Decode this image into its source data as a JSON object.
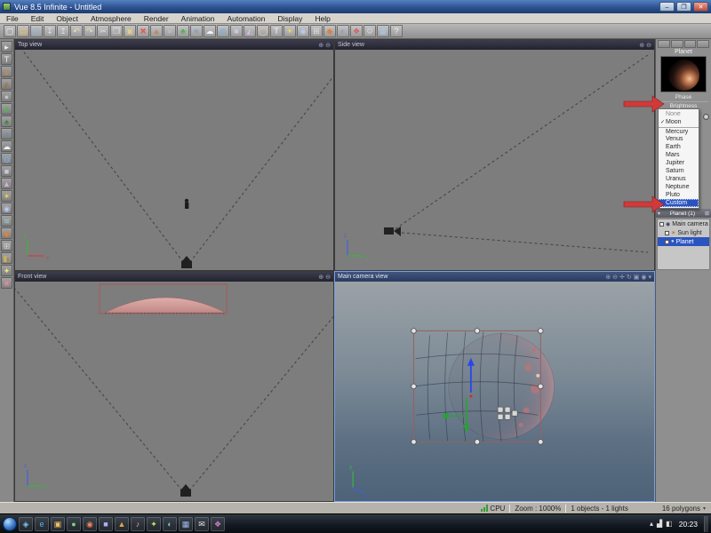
{
  "window": {
    "title": "Vue 8.5 Infinite - Untitled",
    "controls": {
      "minimize": "–",
      "maximize": "❐",
      "close": "✕"
    }
  },
  "menu_bar": {
    "items": [
      {
        "label": "File",
        "name": "menu-file"
      },
      {
        "label": "Edit",
        "name": "menu-edit"
      },
      {
        "label": "Object",
        "name": "menu-object"
      },
      {
        "label": "Atmosphere",
        "name": "menu-atmosphere"
      },
      {
        "label": "Render",
        "name": "menu-render"
      },
      {
        "label": "Animation",
        "name": "menu-animation"
      },
      {
        "label": "Automation",
        "name": "menu-automation"
      },
      {
        "label": "Display",
        "name": "menu-display"
      },
      {
        "label": "Help",
        "name": "menu-help"
      }
    ]
  },
  "toolbar": {
    "icons": [
      {
        "name": "new-file-icon",
        "glyph": "▢",
        "color": "#f2f2f2"
      },
      {
        "name": "open-file-icon",
        "glyph": "▤",
        "color": "#e8c36a"
      },
      {
        "name": "save-file-icon",
        "glyph": "◫",
        "color": "#8ab4e8"
      },
      {
        "name": "import-icon",
        "glyph": "↧",
        "color": "#d8e0ec"
      },
      {
        "name": "export-icon",
        "glyph": "↥",
        "color": "#d8e0ec"
      },
      {
        "name": "undo-icon",
        "glyph": "↶",
        "color": "#ecdfb0"
      },
      {
        "name": "redo-icon",
        "glyph": "↷",
        "color": "#ecdfb0"
      },
      {
        "name": "cut-icon",
        "glyph": "✂",
        "color": "#e0e0e0"
      },
      {
        "name": "copy-icon",
        "glyph": "❐",
        "color": "#e0e0e0"
      },
      {
        "name": "paste-icon",
        "glyph": "▣",
        "color": "#e2cd8e"
      },
      {
        "name": "delete-icon",
        "glyph": "✖",
        "color": "#e06060"
      },
      {
        "name": "terrain-icon",
        "glyph": "▲",
        "color": "#c08a52"
      },
      {
        "name": "rock-icon",
        "glyph": "●",
        "color": "#b9b9b9"
      },
      {
        "name": "plant-icon",
        "glyph": "♣",
        "color": "#55b055"
      },
      {
        "name": "water-icon",
        "glyph": "≈",
        "color": "#5a8ae8"
      },
      {
        "name": "cloud-icon",
        "glyph": "☁",
        "color": "#f0f0f8"
      },
      {
        "name": "sphere-icon",
        "glyph": "◍",
        "color": "#7ab0e0"
      },
      {
        "name": "cube-icon",
        "glyph": "■",
        "color": "#c8c8d8"
      },
      {
        "name": "cone-icon",
        "glyph": "◭",
        "color": "#d8b8e8"
      },
      {
        "name": "torus-icon",
        "glyph": "◯",
        "color": "#e8c8a0"
      },
      {
        "name": "text-icon",
        "glyph": "T",
        "color": "#f4f4f4"
      },
      {
        "name": "light-icon",
        "glyph": "☀",
        "color": "#f0d860"
      },
      {
        "name": "camera-icon",
        "glyph": "◉",
        "color": "#b8c8ec"
      },
      {
        "name": "group-icon",
        "glyph": "⊞",
        "color": "#dddddd"
      },
      {
        "name": "material-icon",
        "glyph": "◆",
        "color": "#e0803a"
      },
      {
        "name": "atmosphere-icon",
        "glyph": "◐",
        "color": "#7a9ae8"
      },
      {
        "name": "render-icon",
        "glyph": "❖",
        "color": "#e05a5a"
      },
      {
        "name": "render-options-icon",
        "glyph": "⚙",
        "color": "#d0d0d0"
      },
      {
        "name": "display-options-icon",
        "glyph": "▦",
        "color": "#a8c8e8"
      },
      {
        "name": "help-icon",
        "glyph": "?",
        "color": "#f4f4f4"
      }
    ]
  },
  "tool_strip": {
    "icons": [
      {
        "name": "select-tool-icon",
        "glyph": "▸",
        "color": "#f0f0f0"
      },
      {
        "name": "text-tool-icon",
        "glyph": "T",
        "color": "#f0f0f0"
      },
      {
        "name": "terrain-tool-icon",
        "glyph": "▲",
        "color": "#c08a52"
      },
      {
        "name": "mountain-tool-icon",
        "glyph": "◭",
        "color": "#9a7448"
      },
      {
        "name": "rock-tool-icon",
        "glyph": "●",
        "color": "#c2c2c2"
      },
      {
        "name": "plant-tool-icon",
        "glyph": "♣",
        "color": "#58b058"
      },
      {
        "name": "tree-tool-icon",
        "glyph": "♠",
        "color": "#3a8a3a"
      },
      {
        "name": "water-tool-icon",
        "glyph": "≈",
        "color": "#5a8ae8"
      },
      {
        "name": "cloud-tool-icon",
        "glyph": "☁",
        "color": "#eef0f6"
      },
      {
        "name": "sphere-tool-icon",
        "glyph": "◍",
        "color": "#7ab0e0"
      },
      {
        "name": "cube-tool-icon",
        "glyph": "■",
        "color": "#c8c8d8"
      },
      {
        "name": "cone-tool-icon",
        "glyph": "▲",
        "color": "#d0b0e0"
      },
      {
        "name": "light-tool-icon",
        "glyph": "☀",
        "color": "#f0d860"
      },
      {
        "name": "camera-tool-icon",
        "glyph": "◉",
        "color": "#b8c8ec"
      },
      {
        "name": "wind-tool-icon",
        "glyph": "≋",
        "color": "#9ad0d0"
      },
      {
        "name": "material-tool-icon",
        "glyph": "◆",
        "color": "#e0803a"
      },
      {
        "name": "group-tool-icon",
        "glyph": "⊞",
        "color": "#dddddd"
      },
      {
        "name": "link-tool-icon",
        "glyph": "◧",
        "color": "#c8b060"
      },
      {
        "name": "magic-tool-icon",
        "glyph": "✦",
        "color": "#e8e870"
      },
      {
        "name": "eco-tool-icon",
        "glyph": "❀",
        "color": "#e08aa8"
      }
    ]
  },
  "viewports": {
    "top": {
      "label": "Top view"
    },
    "side": {
      "label": "Side view"
    },
    "front": {
      "label": "Front view"
    },
    "camera": {
      "label": "Main camera view"
    },
    "small_header_icons": [
      {
        "name": "zoom-in-icon",
        "glyph": "⊕"
      },
      {
        "name": "zoom-out-icon",
        "glyph": "⊖"
      }
    ],
    "camera_header_icons": [
      {
        "name": "zoom-in-icon",
        "glyph": "⊕"
      },
      {
        "name": "zoom-out-icon",
        "glyph": "⊖"
      },
      {
        "name": "pan-icon",
        "glyph": "✛"
      },
      {
        "name": "orbit-icon",
        "glyph": "↻"
      },
      {
        "name": "frame-icon",
        "glyph": "▣"
      },
      {
        "name": "render-view-icon",
        "glyph": "◉"
      },
      {
        "name": "view-options-icon",
        "glyph": "▾"
      }
    ]
  },
  "right_panel": {
    "planet_label": "Planet",
    "phase_label": "Phase",
    "brightness_label": "Brightness",
    "combo_caret": "▾",
    "dropdown_items": [
      {
        "label": "None",
        "check": "",
        "cls": "dim",
        "name": "dropdown-item-none"
      },
      {
        "label": "Moon",
        "check": "✓",
        "cls": "",
        "name": "dropdown-item-moon"
      },
      {
        "label": "Mercury",
        "check": "",
        "cls": "sep",
        "name": "dropdown-item-mercury"
      },
      {
        "label": "Venus",
        "check": "",
        "cls": "",
        "name": "dropdown-item-venus"
      },
      {
        "label": "Earth",
        "check": "",
        "cls": "",
        "name": "dropdown-item-earth"
      },
      {
        "label": "Mars",
        "check": "",
        "cls": "",
        "name": "dropdown-item-mars"
      },
      {
        "label": "Jupiter",
        "check": "",
        "cls": "",
        "name": "dropdown-item-jupiter"
      },
      {
        "label": "Saturn",
        "check": "",
        "cls": "",
        "name": "dropdown-item-saturn"
      },
      {
        "label": "Uranus",
        "check": "",
        "cls": "",
        "name": "dropdown-item-uranus"
      },
      {
        "label": "Neptune",
        "check": "",
        "cls": "",
        "name": "dropdown-item-neptune"
      },
      {
        "label": "Pluto",
        "check": "",
        "cls": "",
        "name": "dropdown-item-pluto"
      },
      {
        "label": "Custom",
        "check": "",
        "cls": "selected",
        "name": "dropdown-item-custom"
      }
    ],
    "group_header": "Planet (1)",
    "group_header_left": "▾",
    "group_header_right": "⊞",
    "scene_tree": [
      {
        "label": "Main camera",
        "name": "tree-item-main-camera",
        "icon": "camera-icon",
        "glyph": "◉",
        "gcolor": "#333a55",
        "pad": "2px",
        "cls": ""
      },
      {
        "label": "Sun light",
        "name": "tree-item-sun-light",
        "icon": "sun-icon",
        "glyph": "☀",
        "gcolor": "#a86a10",
        "pad": "8px",
        "cls": ""
      },
      {
        "label": "Planet",
        "name": "tree-item-planet",
        "icon": "planet-icon",
        "glyph": "●",
        "gcolor": "#cfd8f0",
        "pad": "8px",
        "cls": "selected"
      }
    ]
  },
  "status_bar": {
    "cpu_label": "CPU",
    "zoom": "Zoom : 1000%",
    "objects": "1 objects - 1 lights",
    "polygons": "16 polygons",
    "caret": "▾"
  },
  "taskbar": {
    "time": "20:23",
    "apps": [
      {
        "name": "taskbar-app-icon",
        "glyph": "◈",
        "color": "#7ec0f0"
      },
      {
        "name": "taskbar-app-icon",
        "glyph": "e",
        "color": "#58b0f0"
      },
      {
        "name": "taskbar-app-icon",
        "glyph": "▣",
        "color": "#f0c060"
      },
      {
        "name": "taskbar-app-icon",
        "glyph": "●",
        "color": "#80d080"
      },
      {
        "name": "taskbar-app-icon",
        "glyph": "◉",
        "color": "#f08060"
      },
      {
        "name": "taskbar-app-icon",
        "glyph": "■",
        "color": "#b0b0f0"
      },
      {
        "name": "taskbar-app-icon",
        "glyph": "▲",
        "color": "#e8a050"
      },
      {
        "name": "taskbar-app-icon",
        "glyph": "♪",
        "color": "#f0a0c0"
      },
      {
        "name": "taskbar-app-icon",
        "glyph": "✦",
        "color": "#c0e060"
      },
      {
        "name": "taskbar-app-icon",
        "glyph": "◐",
        "color": "#70c8c8"
      },
      {
        "name": "taskbar-app-icon",
        "glyph": "▦",
        "color": "#a0b8f0"
      },
      {
        "name": "taskbar-app-icon",
        "glyph": "✉",
        "color": "#e8e8e8"
      },
      {
        "name": "taskbar-app-icon",
        "glyph": "❖",
        "color": "#d080d0"
      }
    ],
    "tray": [
      {
        "name": "tray-expand-icon",
        "glyph": "▴"
      },
      {
        "name": "network-icon",
        "glyph": "▟"
      },
      {
        "name": "volume-icon",
        "glyph": "◧"
      }
    ]
  }
}
